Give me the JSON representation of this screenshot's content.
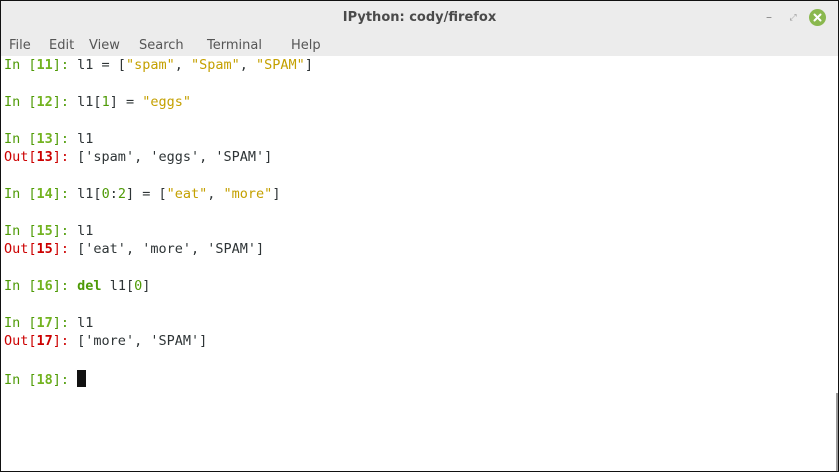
{
  "window": {
    "title": "IPython: cody/firefox",
    "minimize_glyph": "–",
    "maximize_glyph": "⤢",
    "close_icon": "close-icon",
    "close_color": "#8ab84e"
  },
  "menu": {
    "file": "File",
    "edit": "Edit",
    "view": "View",
    "search": "Search",
    "terminal": "Terminal",
    "help": "Help"
  },
  "terminal": {
    "lines": [
      {
        "kind": "in",
        "prompt_pre": "In [",
        "num": "11",
        "prompt_post": "]: ",
        "code": [
          {
            "t": "code",
            "v": "l1 = ["
          },
          {
            "t": "str",
            "v": "\"spam\""
          },
          {
            "t": "code",
            "v": ", "
          },
          {
            "t": "str",
            "v": "\"Spam\""
          },
          {
            "t": "code",
            "v": ", "
          },
          {
            "t": "str",
            "v": "\"SPAM\""
          },
          {
            "t": "code",
            "v": "]"
          }
        ]
      },
      {
        "kind": "in",
        "prompt_pre": "In [",
        "num": "12",
        "prompt_post": "]: ",
        "code": [
          {
            "t": "code",
            "v": "l1["
          },
          {
            "t": "num",
            "v": "1"
          },
          {
            "t": "code",
            "v": "] = "
          },
          {
            "t": "str",
            "v": "\"eggs\""
          }
        ]
      },
      {
        "kind": "in",
        "prompt_pre": "In [",
        "num": "13",
        "prompt_post": "]: ",
        "code": [
          {
            "t": "code",
            "v": "l1"
          }
        ]
      },
      {
        "kind": "out",
        "prompt_pre": "Out[",
        "num": "13",
        "prompt_post": "]: ",
        "code": [
          {
            "t": "code",
            "v": "['spam', 'eggs', 'SPAM']"
          }
        ]
      },
      {
        "kind": "in",
        "prompt_pre": "In [",
        "num": "14",
        "prompt_post": "]: ",
        "code": [
          {
            "t": "code",
            "v": "l1["
          },
          {
            "t": "num",
            "v": "0"
          },
          {
            "t": "code",
            "v": ":"
          },
          {
            "t": "num",
            "v": "2"
          },
          {
            "t": "code",
            "v": "] = ["
          },
          {
            "t": "str",
            "v": "\"eat\""
          },
          {
            "t": "code",
            "v": ", "
          },
          {
            "t": "str",
            "v": "\"more\""
          },
          {
            "t": "code",
            "v": "]"
          }
        ]
      },
      {
        "kind": "in",
        "prompt_pre": "In [",
        "num": "15",
        "prompt_post": "]: ",
        "code": [
          {
            "t": "code",
            "v": "l1"
          }
        ]
      },
      {
        "kind": "out",
        "prompt_pre": "Out[",
        "num": "15",
        "prompt_post": "]: ",
        "code": [
          {
            "t": "code",
            "v": "['eat', 'more', 'SPAM']"
          }
        ]
      },
      {
        "kind": "in",
        "prompt_pre": "In [",
        "num": "16",
        "prompt_post": "]: ",
        "code": [
          {
            "t": "kw",
            "v": "del"
          },
          {
            "t": "code",
            "v": " l1["
          },
          {
            "t": "num",
            "v": "0"
          },
          {
            "t": "code",
            "v": "]"
          }
        ]
      },
      {
        "kind": "in",
        "prompt_pre": "In [",
        "num": "17",
        "prompt_post": "]: ",
        "code": [
          {
            "t": "code",
            "v": "l1"
          }
        ]
      },
      {
        "kind": "out",
        "prompt_pre": "Out[",
        "num": "17",
        "prompt_post": "]: ",
        "code": [
          {
            "t": "code",
            "v": "['more', 'SPAM']"
          }
        ]
      },
      {
        "kind": "in",
        "prompt_pre": "In [",
        "num": "18",
        "prompt_post": "]: ",
        "code": [],
        "cursor": true
      }
    ]
  }
}
